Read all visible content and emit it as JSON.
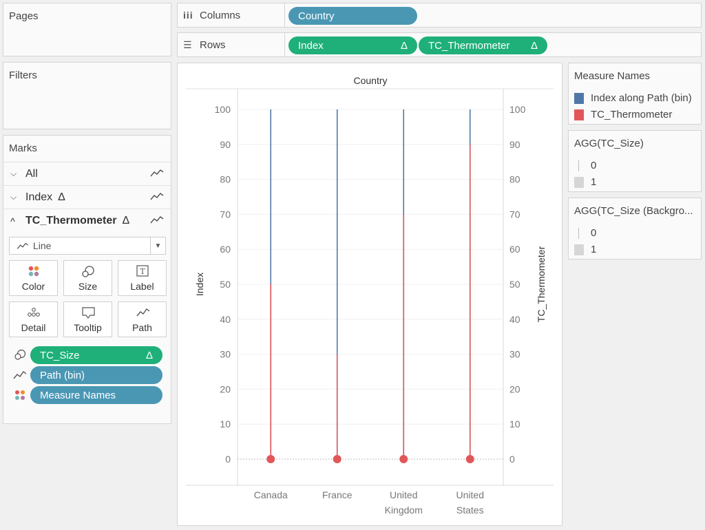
{
  "panels": {
    "pages_title": "Pages",
    "filters_title": "Filters",
    "marks_title": "Marks"
  },
  "shelves": {
    "columns_label": "Columns",
    "rows_label": "Rows",
    "columns_pill": "Country",
    "rows_pills": [
      {
        "label": "Index",
        "delta": "Δ"
      },
      {
        "label": "TC_Thermometer",
        "delta": "Δ"
      }
    ]
  },
  "marks": {
    "rows": [
      {
        "label": "All",
        "delta": ""
      },
      {
        "label": "Index",
        "delta": "Δ"
      },
      {
        "label": "TC_Thermometer",
        "delta": "Δ"
      }
    ],
    "mark_type": "Line",
    "buttons": [
      "Color",
      "Size",
      "Label",
      "Detail",
      "Tooltip",
      "Path"
    ],
    "fields": [
      {
        "label": "TC_Size",
        "delta": "Δ",
        "icon": "size-icon",
        "color": "green"
      },
      {
        "label": "Path (bin)",
        "delta": "",
        "icon": "path-icon",
        "color": "blue"
      },
      {
        "label": "Measure Names",
        "delta": "",
        "icon": "color-icon",
        "color": "blue"
      }
    ]
  },
  "colors": {
    "index_blue": "#4e79a7",
    "thermo_red": "#e15759",
    "pill_blue": "#4a97b4",
    "pill_green": "#1fb07a"
  },
  "chart_data": {
    "type": "line",
    "title": "Country",
    "categories": [
      "Canada",
      "France",
      "United Kingdom",
      "United States"
    ],
    "category_lines": [
      [
        "Canada"
      ],
      [
        "France"
      ],
      [
        "United",
        "Kingdom"
      ],
      [
        "United",
        "States"
      ]
    ],
    "ylabel_left": "Index",
    "ylabel_right": "TC_Thermometer",
    "ylim": [
      0,
      100
    ],
    "yticks": [
      0,
      10,
      20,
      30,
      40,
      50,
      60,
      70,
      80,
      90,
      100
    ],
    "series": [
      {
        "name": "Index along Path (bin)",
        "values": [
          100,
          100,
          100,
          100
        ]
      },
      {
        "name": "TC_Thermometer",
        "values": [
          50,
          30,
          70,
          90
        ]
      }
    ],
    "grid": true
  },
  "legends": {
    "measure_names_title": "Measure Names",
    "measure_names_items": [
      "Index along Path (bin)",
      "TC_Thermometer"
    ],
    "size_title": "AGG(TC_Size)",
    "size_items": [
      "0",
      "1"
    ],
    "size_bg_title": "AGG(TC_Size (Backgro...",
    "size_bg_items": [
      "0",
      "1"
    ]
  }
}
